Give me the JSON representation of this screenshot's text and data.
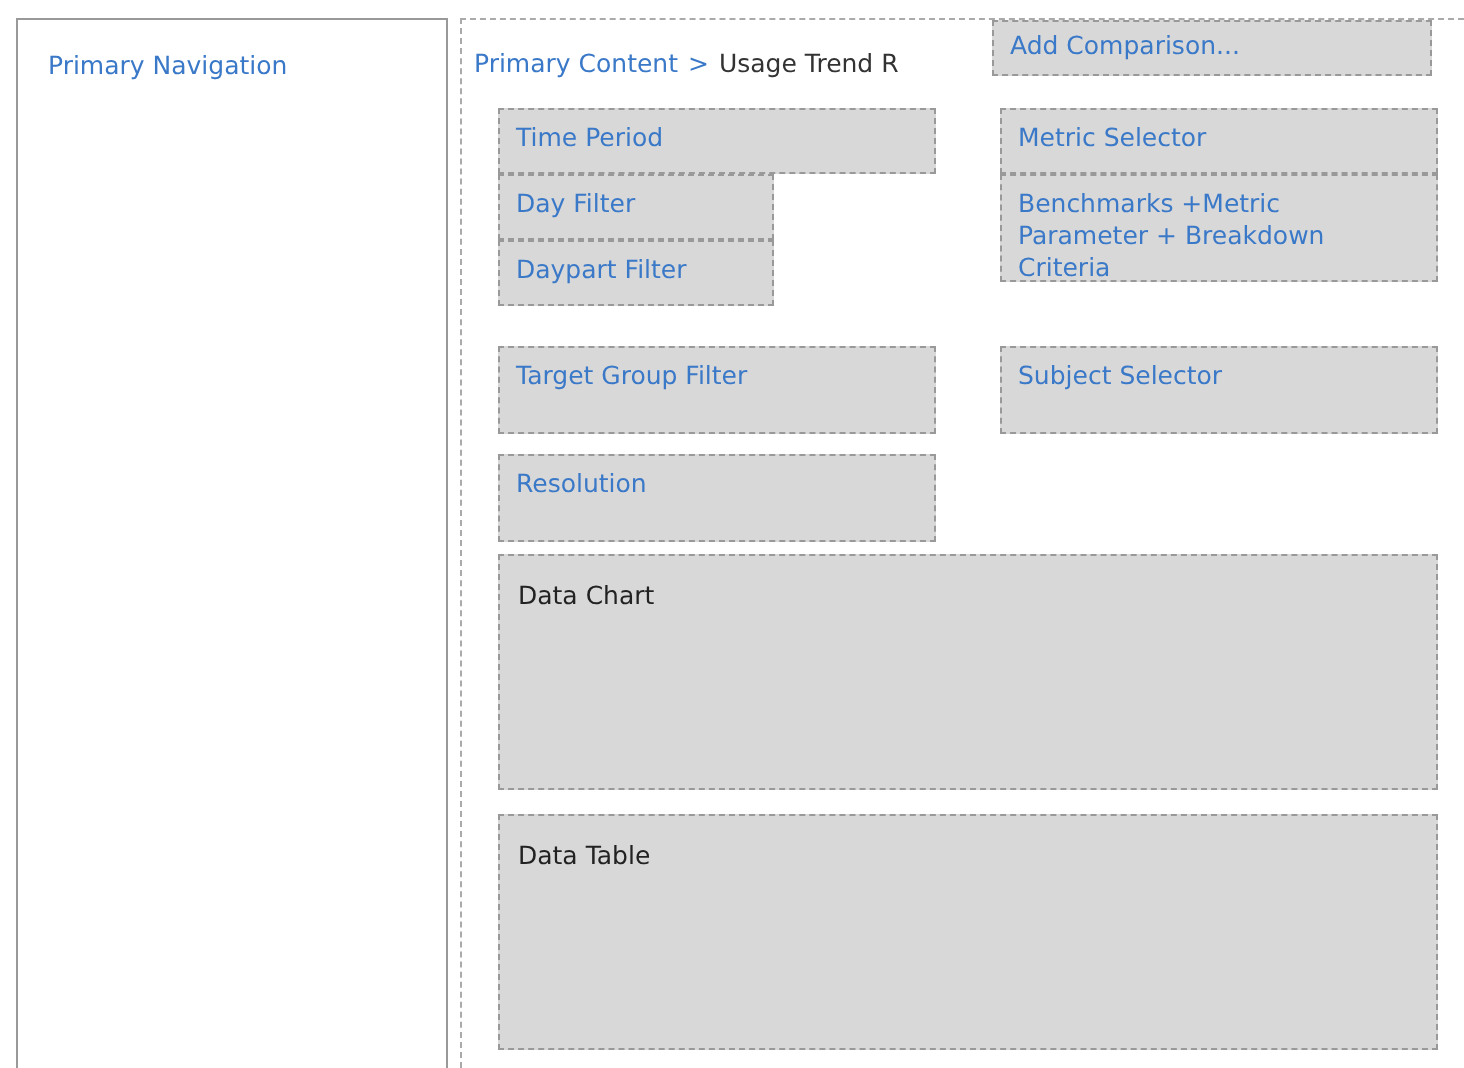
{
  "navigation": {
    "title": "Primary Navigation"
  },
  "breadcrumb": {
    "parent": "Primary Content",
    "separator": ">",
    "current": "Usage Trend R"
  },
  "add_comparison": "Add Comparison...",
  "left_stack": [
    "Time Period",
    "Day Filter",
    "Daypart Filter"
  ],
  "right_stack": [
    "Metric Selector",
    "Benchmarks +Metric Parameter + Breakdown Criteria"
  ],
  "filter_row": [
    "Target Group Filter",
    "Subject Selector"
  ],
  "resolution": "Resolution",
  "panels": [
    "Data Chart",
    "Data Table"
  ]
}
